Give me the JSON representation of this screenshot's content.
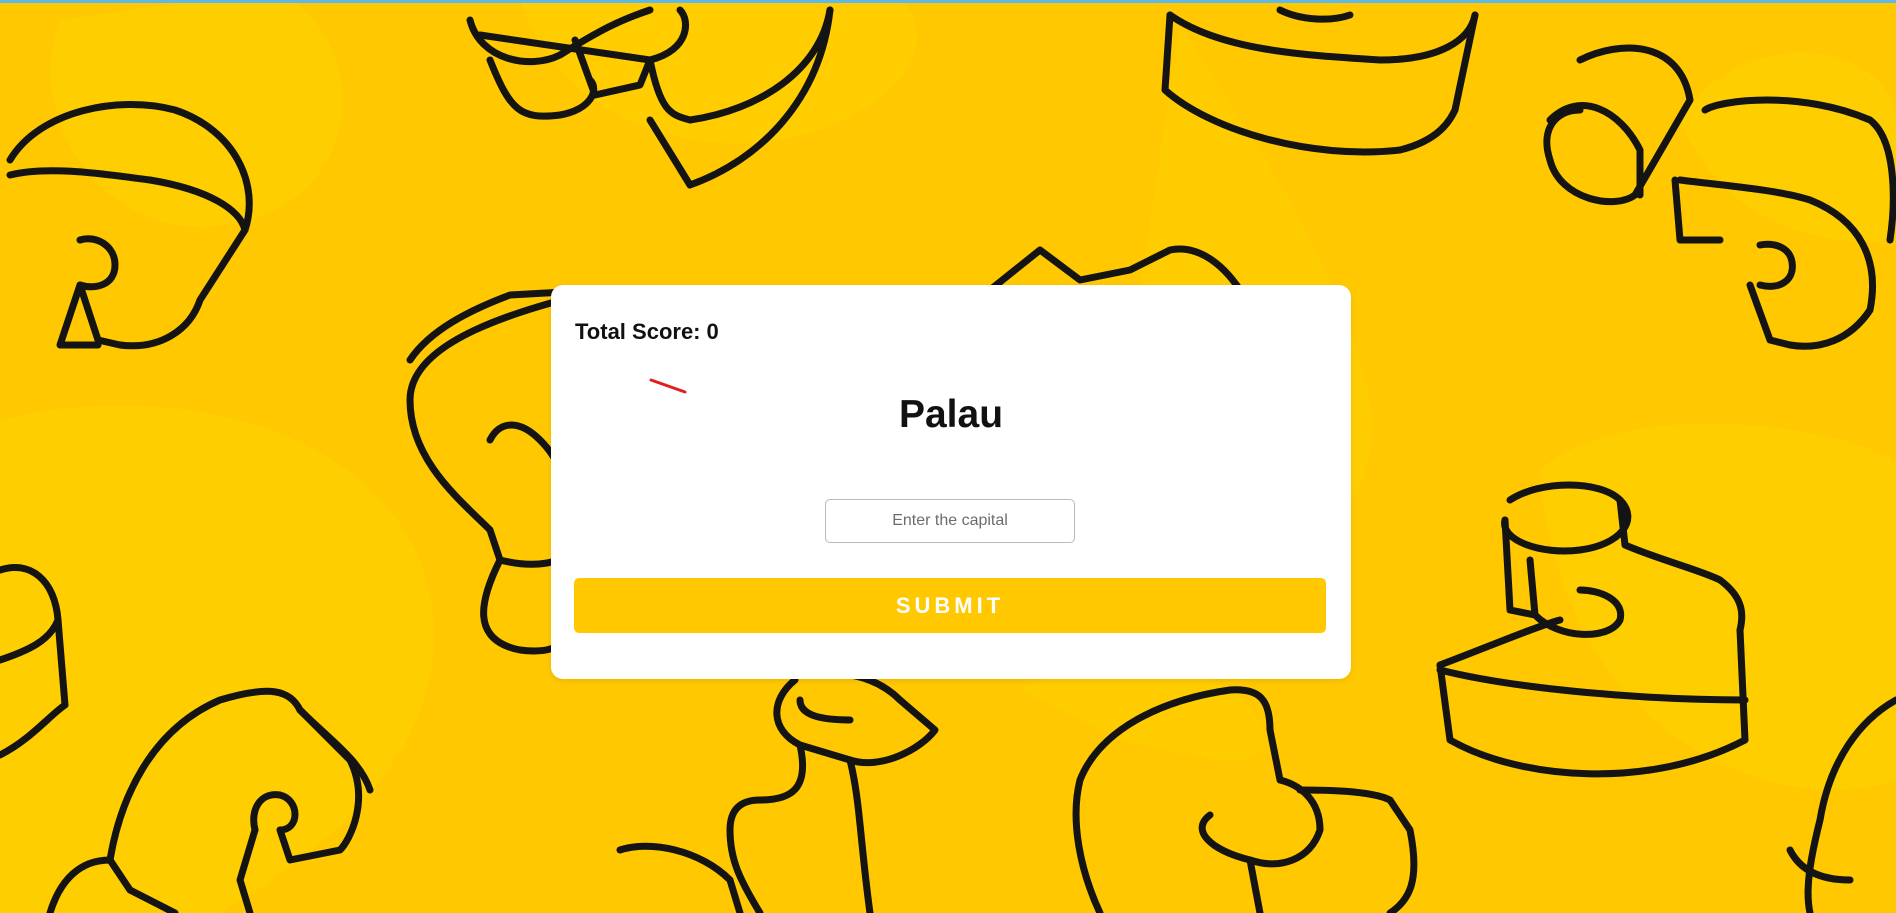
{
  "page": {
    "score_label": "Total Score:",
    "score_value": "0",
    "country": "Palau",
    "answer_placeholder": "Enter the capital",
    "answer_value": "",
    "submit_label": "SUBMIT"
  },
  "colors": {
    "background": "#ffc800",
    "background_blob": "#ffd400",
    "card": "#ffffff",
    "button": "#ffc800",
    "button_text": "#ffffff",
    "loader_mark": "#e02020",
    "outline": "#141414",
    "top_line": "#5fb8e6"
  },
  "icons": {
    "background_pattern": "s-shape-doodle-pattern",
    "loader_mark": "red-dash-mark"
  }
}
